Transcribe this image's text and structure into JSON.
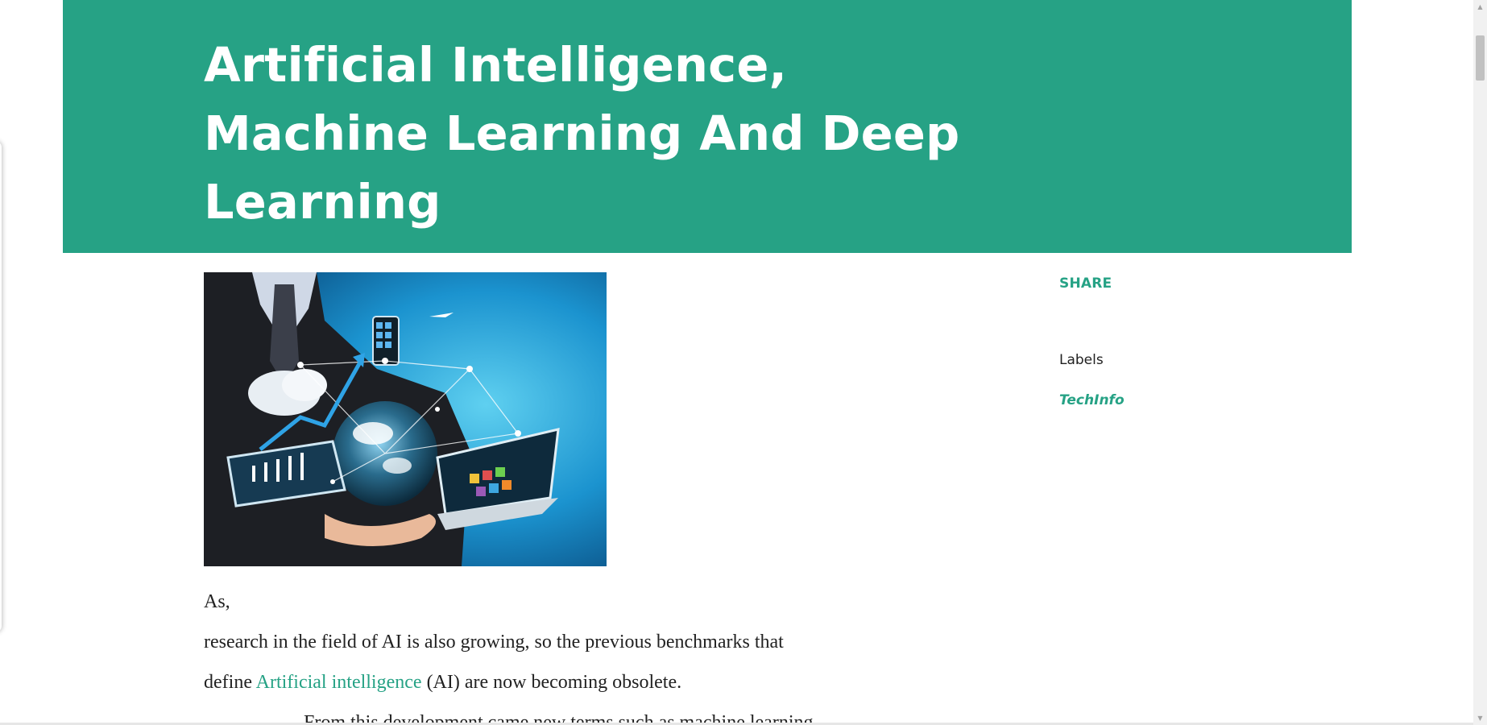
{
  "post": {
    "title": "Artificial Intelligence, Machine Learning And Deep Learning",
    "image_alt": "Businessman holding a globe surrounded by technology devices and network icons",
    "body": {
      "line1": "As,",
      "line2": " research in the field of AI is also growing, so the previous benchmarks that",
      "line3_before": "define ",
      "line3_link": "Artificial intelligence",
      "line3_after": " (AI) are now becoming obsolete.",
      "line4": "From this development came new terms such as machine learning"
    }
  },
  "sidebar": {
    "share_label": "SHARE",
    "labels_heading": "Labels",
    "labels": [
      "TechInfo"
    ]
  },
  "colors": {
    "accent": "#26a285",
    "text": "#222222"
  },
  "icons": {
    "scroll_up": "triangle-up",
    "scroll_down": "triangle-down"
  }
}
